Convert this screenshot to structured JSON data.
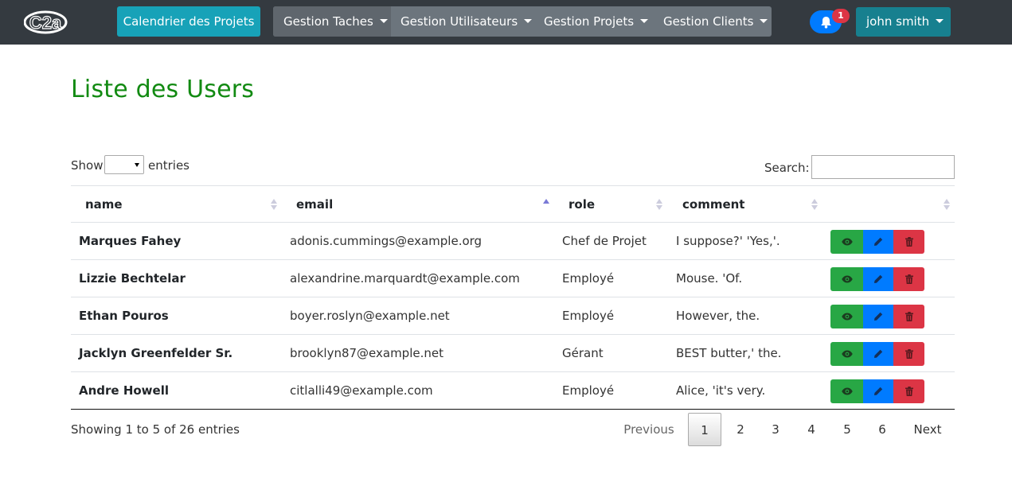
{
  "navbar": {
    "logo_text": "C2a",
    "calendar_label": "Calendrier des Projets",
    "menus": [
      {
        "label": "Gestion Taches"
      },
      {
        "label": "Gestion Utilisateurs"
      },
      {
        "label": "Gestion Projets"
      },
      {
        "label": "Gestion Clients"
      }
    ],
    "notification_count": "1",
    "user_name": "john smith"
  },
  "page": {
    "title": "Liste des Users"
  },
  "controls": {
    "show_label": "Show",
    "show_value": "",
    "entries_label": "entries",
    "search_label": "Search:",
    "search_value": ""
  },
  "table": {
    "columns": [
      {
        "label": "name"
      },
      {
        "label": "email"
      },
      {
        "label": "role"
      },
      {
        "label": "comment"
      },
      {
        "label": ""
      }
    ],
    "rows": [
      {
        "name": "Marques Fahey",
        "email": "adonis.cummings@example.org",
        "role": "Chef de Projet",
        "comment": "I suppose?' 'Yes,'."
      },
      {
        "name": "Lizzie Bechtelar",
        "email": "alexandrine.marquardt@example.com",
        "role": "Employé",
        "comment": "Mouse. 'Of."
      },
      {
        "name": "Ethan Pouros",
        "email": "boyer.roslyn@example.net",
        "role": "Employé",
        "comment": "However, the."
      },
      {
        "name": "Jacklyn Greenfelder Sr.",
        "email": "brooklyn87@example.net",
        "role": "Gérant",
        "comment": "BEST butter,' the."
      },
      {
        "name": "Andre Howell",
        "email": "citlalli49@example.com",
        "role": "Employé",
        "comment": "Alice, 'it's very."
      }
    ]
  },
  "footer": {
    "info": "Showing 1 to 5 of 26 entries",
    "previous": "Previous",
    "pages": [
      "1",
      "2",
      "3",
      "4",
      "5",
      "6"
    ],
    "next": "Next"
  },
  "colors": {
    "navbar_bg": "#343a40",
    "calendar_btn": "#17a2b8",
    "title_green": "#128a12",
    "view_btn": "#28a745",
    "edit_btn": "#007bff",
    "delete_btn": "#dc3545"
  }
}
